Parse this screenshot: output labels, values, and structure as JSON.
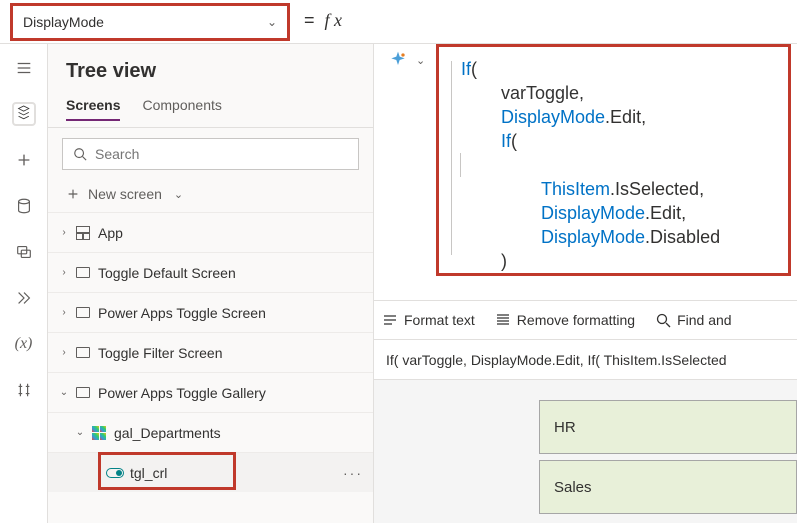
{
  "propertyDropdown": {
    "label": "DisplayMode"
  },
  "treeView": {
    "title": "Tree view",
    "tabs": {
      "screens": "Screens",
      "components": "Components"
    },
    "search_placeholder": "Search",
    "newScreen": "New screen",
    "items": {
      "app": "App",
      "toggleDefault": "Toggle Default Screen",
      "powerAppsToggle": "Power Apps Toggle Screen",
      "toggleFilter": "Toggle Filter Screen",
      "powerAppsGallery": "Power Apps Toggle Gallery",
      "galDepartments": "gal_Departments",
      "tglCrl": "tgl_crl"
    }
  },
  "formula": {
    "l1a": "If",
    "l1b": "(",
    "l2": "varToggle,",
    "l3a": "DisplayMode",
    "l3b": ".Edit,",
    "l4a": "If",
    "l4b": "(",
    "l5a": "ThisItem",
    "l5b": ".IsSelected,",
    "l6a": "DisplayMode",
    "l6b": ".Edit,",
    "l7a": "DisplayMode",
    "l7b": ".Disabled",
    "l8": ")",
    "l9": ")"
  },
  "formulaBar": {
    "formatText": "Format text",
    "removeFormatting": "Remove formatting",
    "find": "Find and"
  },
  "oneLiner": "If( varToggle, DisplayMode.Edit, If( ThisItem.IsSelected",
  "gallery": {
    "row1": "HR",
    "row2": "Sales"
  }
}
